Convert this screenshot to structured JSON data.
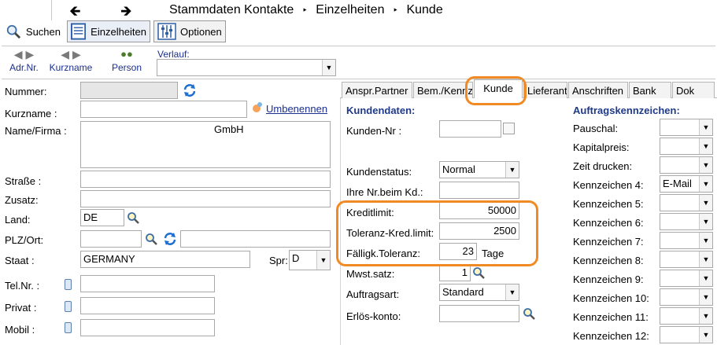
{
  "breadcrumb": {
    "back_icon": "arrow-left-icon",
    "forward_icon": "arrow-right-icon",
    "items": [
      "Stammdaten Kontakte",
      "Einzelheiten",
      "Kunde"
    ],
    "separator": "‣"
  },
  "toolbar": {
    "search_label": "Suchen",
    "details_label": "Einzelheiten",
    "options_label": "Optionen"
  },
  "nav": {
    "adrnr_label": "Adr.Nr.",
    "kurzname_label": "Kurzname",
    "person_label": "Person",
    "verlauf_label": "Verlauf:",
    "verlauf_value": ""
  },
  "left_form": {
    "nummer_label": "Nummer:",
    "nummer_value": "",
    "kurzname_label": "Kurzname :",
    "kurzname_value": "",
    "umbenennen_label": "Umbenennen",
    "name_label": "Name/Firma :",
    "name_value": "GmbH",
    "strasse_label": "Straße :",
    "strasse_value": "",
    "zusatz_label": "Zusatz:",
    "zusatz_value": "",
    "land_label": "Land:",
    "land_value": "DE",
    "plz_label": "PLZ/Ort:",
    "plz_value": "",
    "ort_value": "",
    "staat_label": "Staat :",
    "staat_value": "GERMANY",
    "spr_label": "Spr:",
    "spr_value": "D",
    "tel_label": "Tel.Nr. :",
    "tel_value": "",
    "privat_label": "Privat :",
    "privat_value": "",
    "mobil_label": "Mobil :",
    "mobil_value": ""
  },
  "tabs": [
    "Anspr.Partner",
    "Bem./Kennz.",
    "Kunde",
    "Lieferant",
    "Anschriften",
    "Bank",
    "Dok"
  ],
  "active_tab": "Kunde",
  "kundendaten": {
    "title": "Kundendaten:",
    "kunden_nr_label": "Kunden-Nr :",
    "kunden_nr_value": "",
    "kundenstatus_label": "Kundenstatus:",
    "kundenstatus_value": "Normal",
    "ihre_nr_label": "Ihre Nr.beim Kd.:",
    "ihre_nr_value": "",
    "kreditlimit_label": "Kreditlimit:",
    "kreditlimit_value": "50000",
    "toleranz_label": "Toleranz-Kred.limit:",
    "toleranz_value": "2500",
    "faellig_label": "Fälligk.Toleranz:",
    "faellig_value": "23",
    "faellig_unit": "Tage",
    "mwst_label": "Mwst.satz:",
    "mwst_value": "1",
    "auftragsart_label": "Auftragsart:",
    "auftragsart_value": "Standard",
    "erloes_label": "Erlös-konto:",
    "erloes_value": ""
  },
  "auftrag": {
    "title": "Auftragskennzeichen:",
    "rows": [
      {
        "label": "Pauschal:",
        "value": ""
      },
      {
        "label": "Kapitalpreis:",
        "value": ""
      },
      {
        "label": "Zeit drucken:",
        "value": ""
      },
      {
        "label": "Kennzeichen 4:",
        "value": "E-Mail"
      },
      {
        "label": "Kennzeichen 5:",
        "value": ""
      },
      {
        "label": "Kennzeichen 6:",
        "value": ""
      },
      {
        "label": "Kennzeichen 7:",
        "value": ""
      },
      {
        "label": "Kennzeichen 8:",
        "value": ""
      },
      {
        "label": "Kennzeichen 9:",
        "value": ""
      },
      {
        "label": "Kennzeichen 10:",
        "value": ""
      },
      {
        "label": "Kennzeichen 11:",
        "value": ""
      },
      {
        "label": "Kennzeichen 12:",
        "value": ""
      }
    ]
  },
  "colors": {
    "highlight": "#f08a24",
    "section_title": "#1f3a8a",
    "link": "#1a2f8f",
    "refresh": "#1f6fd1"
  }
}
